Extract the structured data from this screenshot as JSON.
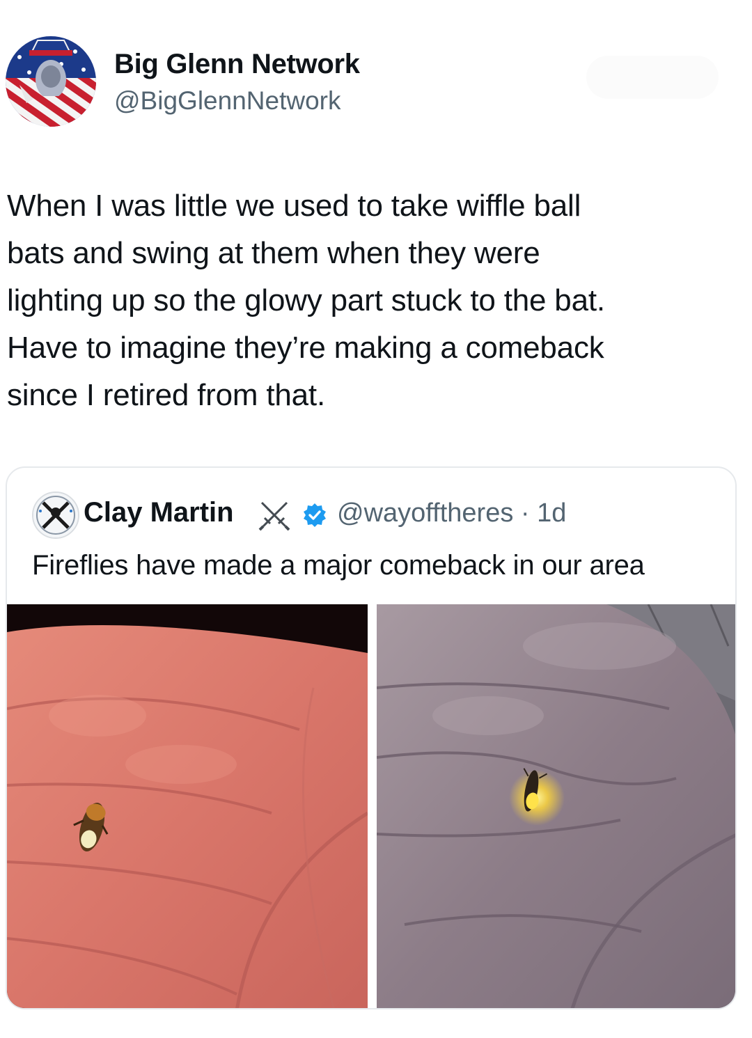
{
  "tweet": {
    "author": {
      "display_name": "Big Glenn Network",
      "handle": "@BigGlennNetwork"
    },
    "text": "When I was little we used to take wiffle ball\nbats and swing at them when they were\nlighting up so the glowy part stuck to the bat.\nHave to imagine they’re making a comeback\nsince I retired from that."
  },
  "quoted_tweet": {
    "display_name": "Clay Martin",
    "handle_time": "@wayofftheres · 1d",
    "text": "Fireflies have made a major comeback in our area",
    "badges": [
      "crossed-swords-icon",
      "verified-badge-icon"
    ],
    "photos": [
      {
        "name": "photo-firefly-hand-1",
        "subject": "firefly in palm"
      },
      {
        "name": "photo-firefly-glowing-hand-2",
        "subject": "glowing firefly in palm"
      }
    ]
  },
  "colors": {
    "text_primary": "#0f1419",
    "text_secondary": "#536471",
    "verified_blue": "#1d9bf0",
    "card_border": "#e6e9ec"
  }
}
